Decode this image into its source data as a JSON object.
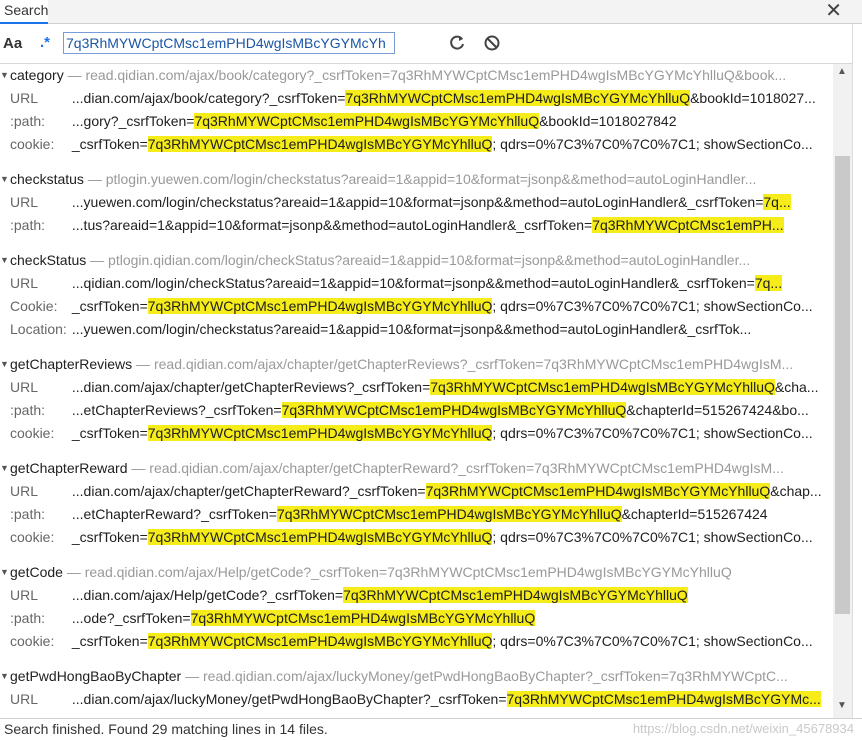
{
  "tab": {
    "label": "Search"
  },
  "toolbar": {
    "case_label": "Aa",
    "regex_label": ".*",
    "query": "7q3RhMYWCptCMsc1emPHD4wgIsMBcYGYMcYh"
  },
  "token": "7q3RhMYWCptCMsc1emPHD4wgIsMBcYGYMcYhlluQ",
  "groups": [
    {
      "name": "category",
      "url": "read.qidian.com/ajax/book/category?_csrfToken=7q3RhMYWCptCMsc1emPHD4wgIsMBcYGYMcYhlluQ&book...",
      "lines": [
        {
          "key": "URL",
          "pre": "...dian.com/ajax/book/category?_csrfToken=",
          "hl": "7q3RhMYWCptCMsc1emPHD4wgIsMBcYGYMcYhlluQ",
          "post": "&bookId=1018027..."
        },
        {
          "key": ":path:",
          "pre": "...gory?_csrfToken=",
          "hl": "7q3RhMYWCptCMsc1emPHD4wgIsMBcYGYMcYhlluQ",
          "post": "&bookId=1018027842"
        },
        {
          "key": "cookie:",
          "pre": "_csrfToken=",
          "hl": "7q3RhMYWCptCMsc1emPHD4wgIsMBcYGYMcYhlluQ",
          "post": "; qdrs=0%7C3%7C0%7C0%7C1; showSectionCo..."
        }
      ]
    },
    {
      "name": "checkstatus",
      "url": "ptlogin.yuewen.com/login/checkstatus?areaid=1&appid=10&format=jsonp&&method=autoLoginHandler...",
      "lines": [
        {
          "key": "URL",
          "pre": "...yuewen.com/login/checkstatus?areaid=1&appid=10&format=jsonp&&method=autoLoginHandler&_csrfToken=",
          "hl": "7q...",
          "post": ""
        },
        {
          "key": ":path:",
          "pre": "...tus?areaid=1&appid=10&format=jsonp&&method=autoLoginHandler&_csrfToken=",
          "hl": "7q3RhMYWCptCMsc1emPH...",
          "post": ""
        }
      ]
    },
    {
      "name": "checkStatus",
      "url": "ptlogin.qidian.com/login/checkStatus?areaid=1&appid=10&format=jsonp&&method=autoLoginHandler...",
      "lines": [
        {
          "key": "URL",
          "pre": "...qidian.com/login/checkStatus?areaid=1&appid=10&format=jsonp&&method=autoLoginHandler&_csrfToken=",
          "hl": "7q...",
          "post": ""
        },
        {
          "key": "Cookie:",
          "pre": "_csrfToken=",
          "hl": "7q3RhMYWCptCMsc1emPHD4wgIsMBcYGYMcYhlluQ",
          "post": "; qdrs=0%7C3%7C0%7C0%7C1; showSectionCo..."
        },
        {
          "key": "Location:",
          "pre": "...yuewen.com/login/checkstatus?areaid=1&appid=10&format=jsonp&&method=autoLoginHandler&_csrfTok...",
          "hl": "",
          "post": ""
        }
      ]
    },
    {
      "name": "getChapterReviews",
      "url": "read.qidian.com/ajax/chapter/getChapterReviews?_csrfToken=7q3RhMYWCptCMsc1emPHD4wgIsM...",
      "lines": [
        {
          "key": "URL",
          "pre": "...dian.com/ajax/chapter/getChapterReviews?_csrfToken=",
          "hl": "7q3RhMYWCptCMsc1emPHD4wgIsMBcYGYMcYhlluQ",
          "post": "&cha..."
        },
        {
          "key": ":path:",
          "pre": "...etChapterReviews?_csrfToken=",
          "hl": "7q3RhMYWCptCMsc1emPHD4wgIsMBcYGYMcYhlluQ",
          "post": "&chapterId=515267424&bo..."
        },
        {
          "key": "cookie:",
          "pre": "_csrfToken=",
          "hl": "7q3RhMYWCptCMsc1emPHD4wgIsMBcYGYMcYhlluQ",
          "post": "; qdrs=0%7C3%7C0%7C0%7C1; showSectionCo..."
        }
      ]
    },
    {
      "name": "getChapterReward",
      "url": "read.qidian.com/ajax/chapter/getChapterReward?_csrfToken=7q3RhMYWCptCMsc1emPHD4wgIsM...",
      "lines": [
        {
          "key": "URL",
          "pre": "...dian.com/ajax/chapter/getChapterReward?_csrfToken=",
          "hl": "7q3RhMYWCptCMsc1emPHD4wgIsMBcYGYMcYhlluQ",
          "post": "&chap..."
        },
        {
          "key": ":path:",
          "pre": "...etChapterReward?_csrfToken=",
          "hl": "7q3RhMYWCptCMsc1emPHD4wgIsMBcYGYMcYhlluQ",
          "post": "&chapterId=515267424"
        },
        {
          "key": "cookie:",
          "pre": "_csrfToken=",
          "hl": "7q3RhMYWCptCMsc1emPHD4wgIsMBcYGYMcYhlluQ",
          "post": "; qdrs=0%7C3%7C0%7C0%7C1; showSectionCo..."
        }
      ]
    },
    {
      "name": "getCode",
      "url": "read.qidian.com/ajax/Help/getCode?_csrfToken=7q3RhMYWCptCMsc1emPHD4wgIsMBcYGYMcYhlluQ",
      "lines": [
        {
          "key": "URL",
          "pre": "...dian.com/ajax/Help/getCode?_csrfToken=",
          "hl": "7q3RhMYWCptCMsc1emPHD4wgIsMBcYGYMcYhlluQ",
          "post": ""
        },
        {
          "key": ":path:",
          "pre": "...ode?_csrfToken=",
          "hl": "7q3RhMYWCptCMsc1emPHD4wgIsMBcYGYMcYhlluQ",
          "post": ""
        },
        {
          "key": "cookie:",
          "pre": "_csrfToken=",
          "hl": "7q3RhMYWCptCMsc1emPHD4wgIsMBcYGYMcYhlluQ",
          "post": "; qdrs=0%7C3%7C0%7C0%7C1; showSectionCo..."
        }
      ]
    },
    {
      "name": "getPwdHongBaoByChapter",
      "url": "read.qidian.com/ajax/luckyMoney/getPwdHongBaoByChapter?_csrfToken=7q3RhMYWCptC...",
      "lines": [
        {
          "key": "URL",
          "pre": "...dian.com/ajax/luckyMoney/getPwdHongBaoByChapter?_csrfToken=",
          "hl": "7q3RhMYWCptCMsc1emPHD4wgIsMBcYGYMc...",
          "post": ""
        }
      ]
    }
  ],
  "status": {
    "text": "Search finished.  Found 29 matching lines in 14 files."
  },
  "watermark": "https://blog.csdn.net/weixin_45678934"
}
